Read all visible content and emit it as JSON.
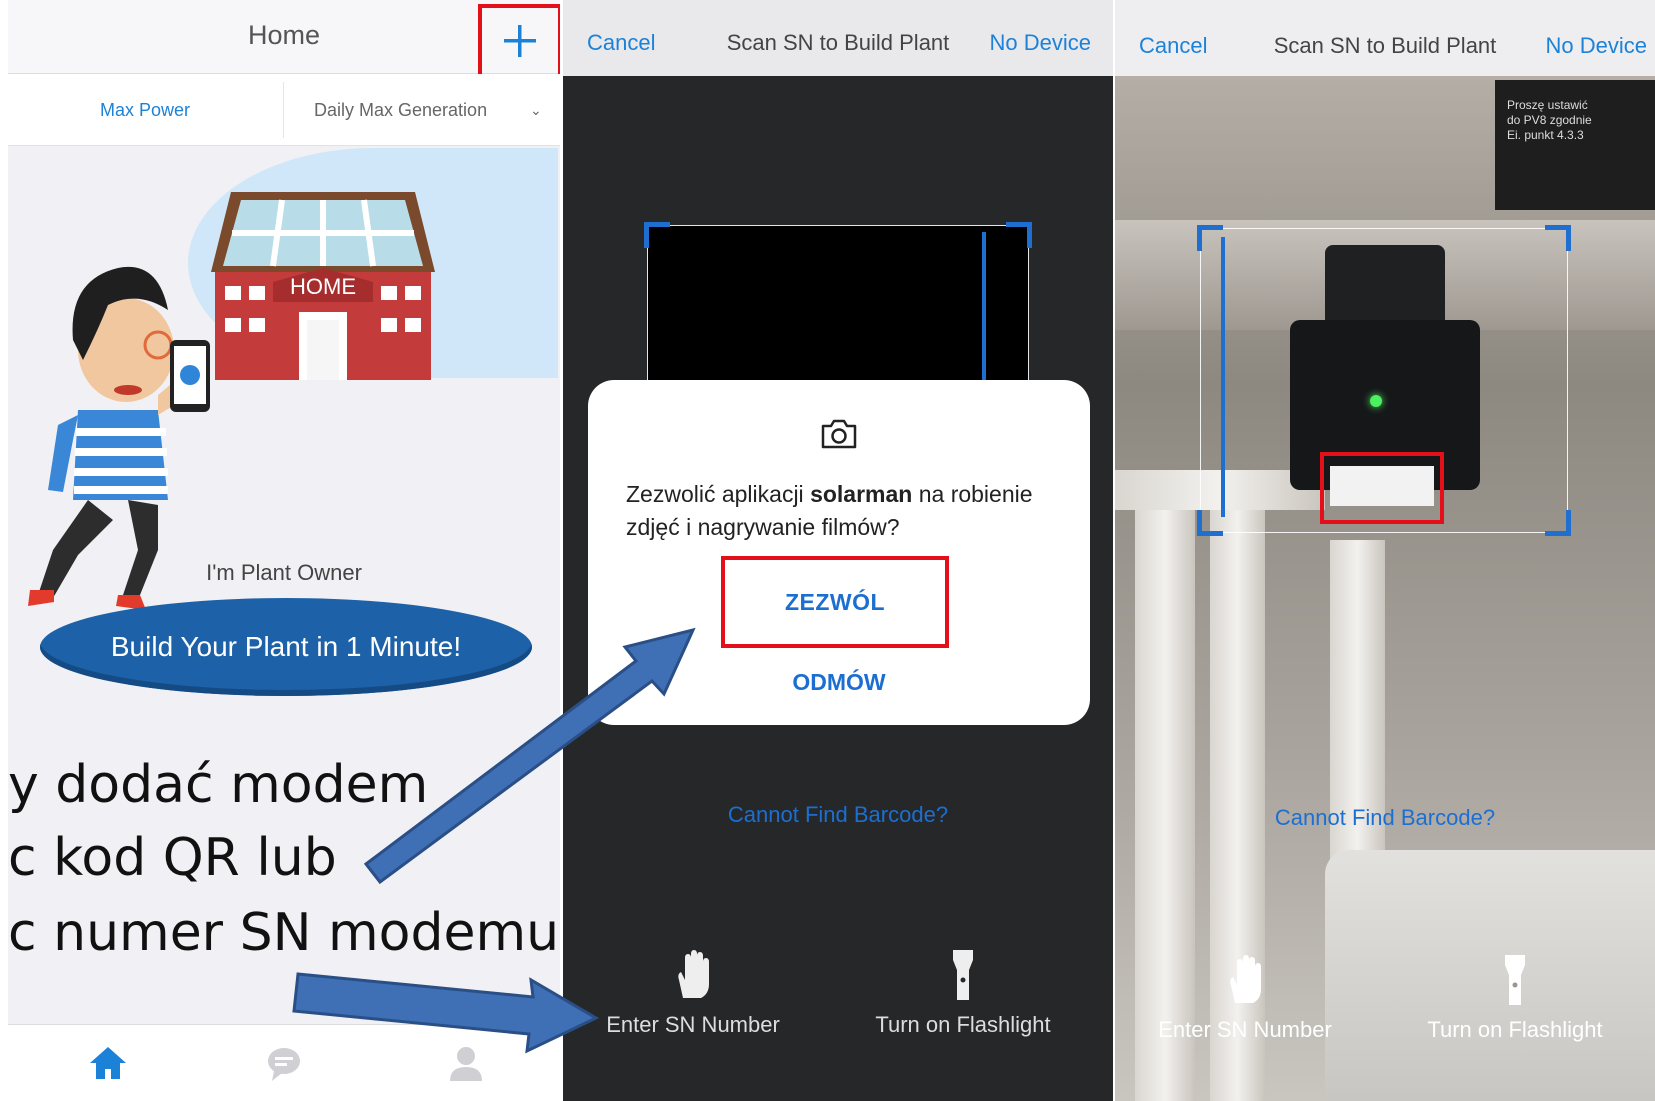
{
  "panel_home": {
    "title": "Home",
    "tabs": {
      "max_power": "Max Power",
      "daily_max_generation": "Daily Max Generation"
    },
    "owner_text": "I'm Plant Owner",
    "build_button": "Build Your Plant in 1 Minute!",
    "house_sign": "HOME",
    "nav_icons": [
      "home-icon",
      "chat-icon",
      "user-icon"
    ],
    "overlay_text": [
      "y dodać modem",
      "c kod QR lub",
      "c numer SN modemu."
    ]
  },
  "panel_scan_dialog": {
    "cancel": "Cancel",
    "title": "Scan SN to Build Plant",
    "no_device": "No Device",
    "dialog": {
      "text_before": "Zezwolić aplikacji ",
      "app_name": "solarman",
      "text_after": " na robienie zdjęć i nagrywanie filmów?",
      "allow": "ZEZWÓL",
      "deny": "ODMÓW"
    },
    "cannot_find": "Cannot Find Barcode?",
    "enter_sn": "Enter SN Number",
    "flashlight": "Turn on Flashlight"
  },
  "panel_scan_camera": {
    "cancel": "Cancel",
    "title": "Scan SN to Build Plant",
    "no_device": "No Device",
    "cannot_find": "Cannot Find Barcode?",
    "enter_sn": "Enter SN Number",
    "flashlight": "Turn on Flashlight",
    "board_text": [
      "Proszę ustawić",
      "do PV8 zgodnie",
      "Ei. punkt 4.3.3"
    ]
  },
  "colors": {
    "accent": "#1c82d8",
    "highlight": "#e3101a",
    "button": "#1d61a8",
    "arrow": "#3f6fb5"
  }
}
